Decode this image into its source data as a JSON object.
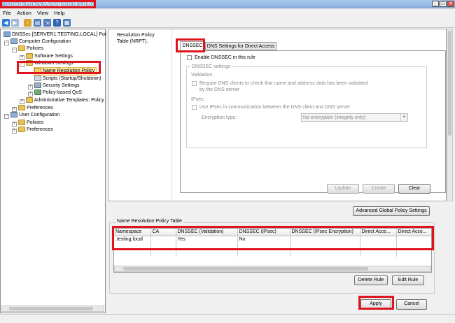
{
  "window": {
    "title": "Group Policy Management Editor",
    "min": "_",
    "max": "□",
    "close": "✕"
  },
  "menu": [
    "File",
    "Action",
    "View",
    "Help"
  ],
  "tree": {
    "root": "DNSSec [SERVER1.TESTING.LOCAL] Policy",
    "computer_config": "Computer Configuration",
    "policies": "Policies",
    "software_settings": "Software Settings",
    "windows_settings": "Windows Settings",
    "name_resolution_policy": "Name Resolution Policy",
    "scripts": "Scripts (Startup/Shutdown)",
    "security_settings": "Security Settings",
    "qos": "Policy-based QoS",
    "admin_templates": "Administrative Templates: Policy",
    "preferences": "Preferences",
    "user_config": "User Configuration",
    "user_policies": "Policies",
    "user_preferences": "Preferences"
  },
  "main": {
    "nrpt_label": "Resolution Policy Table (NRPT).",
    "tabs": [
      "DNSSEC",
      "DNS Settings for Direct Access"
    ],
    "enable_dnssec": "Enable DNSSEC in this rule",
    "group_title": "DNSSEC settings",
    "validation_label": "Validation:",
    "require_validation": "Require DNS clients to check that name and address data has been validated by the DNS server",
    "ipsec_label": "IPsec:",
    "use_ipsec": "Use IPsec in communication between the DNS client and DNS server",
    "encryption_label": "Encryption type:",
    "encryption_value": "No encryption (integrity only)",
    "update": "Update",
    "create": "Create",
    "clear": "Clear",
    "advanced": "Advanced Global Policy Settings",
    "table_title": "Name Resolution Policy Table",
    "columns": [
      "Namespace",
      "CA",
      "DNSSEC (Validation)",
      "DNSSEC (IPsec)",
      "DNSSEC (IPsec Encryption)",
      "Direct Acce...",
      "Direct Acce..."
    ],
    "rows": [
      [
        ".testing.local",
        "",
        "Yes",
        "No",
        "",
        "",
        ""
      ]
    ],
    "delete_rule": "Delete Rule",
    "edit_rule": "Edit Rule",
    "apply": "Apply",
    "cancel": "Cancel"
  }
}
